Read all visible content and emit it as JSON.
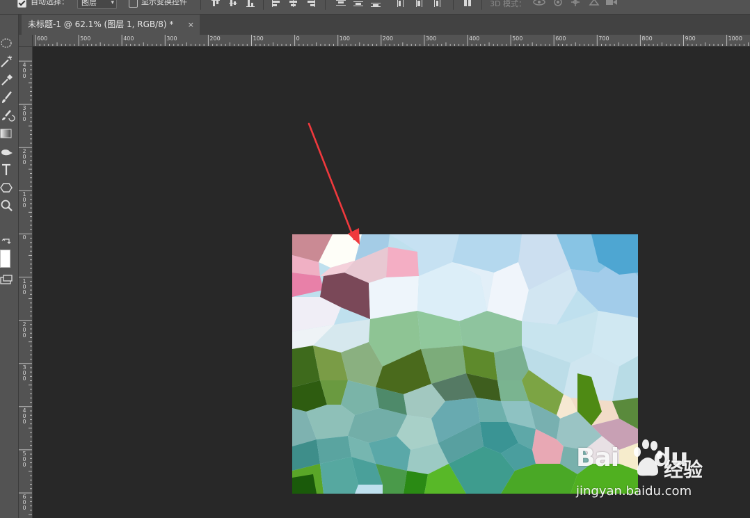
{
  "options_bar": {
    "auto_select_label": "自动选择：",
    "auto_select_checked": true,
    "auto_select_target": "图层",
    "show_transform_label": "显示变换控件",
    "show_transform_checked": false,
    "mode_3d_label": "3D 模式："
  },
  "document": {
    "tab_title": "未标题-1 @ 62.1% (图层 1, RGB/8) *",
    "tab_close": "×"
  },
  "rulers": {
    "horizontal": [
      "600",
      "500",
      "400",
      "300",
      "200",
      "100",
      "0",
      "100",
      "200",
      "300",
      "400",
      "500",
      "600",
      "700",
      "800",
      "900",
      "1000"
    ],
    "vertical": [
      "400",
      "300",
      "200",
      "100",
      "0",
      "100",
      "200",
      "300",
      "400",
      "500",
      "600"
    ]
  },
  "colors": {
    "accent_arrow": "#f0393d",
    "foreground_swatch": "#ffffff"
  },
  "watermark": {
    "logo_text": "Bai",
    "logo_text_2": "du",
    "cn_text": "经验",
    "url": "jingyan.baidu.com"
  }
}
